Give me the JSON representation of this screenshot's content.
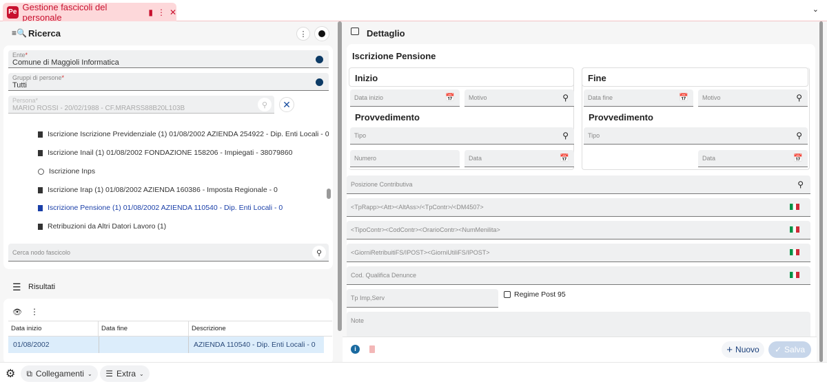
{
  "tab": {
    "title": "Gestione fascicoli del personale",
    "logo": "PE"
  },
  "ricerca": {
    "title": "Ricerca",
    "ente": {
      "label": "Ente",
      "value": "Comune di Maggioli Informatica"
    },
    "gruppi": {
      "label": "Gruppi di persone",
      "value": "Tutti"
    },
    "persona": {
      "label": "Persona",
      "value": "MARIO ROSSI - 20/02/1988 - CF.MRARSS88B20L103B"
    },
    "tree": [
      {
        "label": "Iscrizione Iscrizione Previdenziale (1) 01/08/2002 AZIENDA 254922 - Dip. Enti Locali - 0",
        "icon": "document-icon"
      },
      {
        "label": "Iscrizione Inail (1) 01/08/2002 FONDAZIONE 158206 - Impiegati - 38079860",
        "icon": "document-icon"
      },
      {
        "label": "Iscrizione Inps",
        "icon": "circle-icon"
      },
      {
        "label": "Iscrizione Irap (1) 01/08/2002 AZIENDA 160386 - Imposta Regionale - 0",
        "icon": "document-icon"
      },
      {
        "label": "Iscrizione Pensione (1) 01/08/2002 AZIENDA 110540 - Dip. Enti Locali - 0",
        "icon": "document-icon",
        "selected": true
      },
      {
        "label": "Retribuzioni da Altri Datori Lavoro (1)",
        "icon": "document-icon"
      }
    ],
    "search_placeholder": "Cerca nodo fascicolo"
  },
  "risultati": {
    "title": "Risultati",
    "columns": [
      "Data inizio",
      "Data fine",
      "Descrizione"
    ],
    "rows": [
      {
        "inizio": "01/08/2002",
        "fine": "",
        "descrizione": "AZIENDA 110540 - Dip. Enti Locali - 0"
      }
    ]
  },
  "footer": {
    "collegamenti": "Collegamenti",
    "extra": "Extra"
  },
  "dettaglio": {
    "title": "Dettaglio",
    "section": "Iscrizione Pensione",
    "inizio": "Inizio",
    "fine": "Fine",
    "provvedimento": "Provvedimento",
    "data_inizio": "Data inizio",
    "data_fine": "Data fine",
    "motivo": "Motivo",
    "tipo": "Tipo",
    "numero": "Numero",
    "data": "Data",
    "posizione": "Posizione Contributiva",
    "f1": "<TpRapp><Att><AltAss>/<TpContr>/<DM4507>",
    "f2": "<TipoContr><CodContr><OrarioContr><NumMenilita>",
    "f3": "<GiorniRetribuitiFS/IPOST><GiorniUtiliFS/IPOST>",
    "f4": "Cod. Qualifica Denunce",
    "tp_imp": "Tp Imp,Serv",
    "regime": "Regime Post 95",
    "note": "Note",
    "nuovo": "Nuovo",
    "salva": "Salva"
  },
  "colors": {
    "brand": "#c8102e",
    "accent": "#0d3b66",
    "selected": "#1a3fa8"
  }
}
